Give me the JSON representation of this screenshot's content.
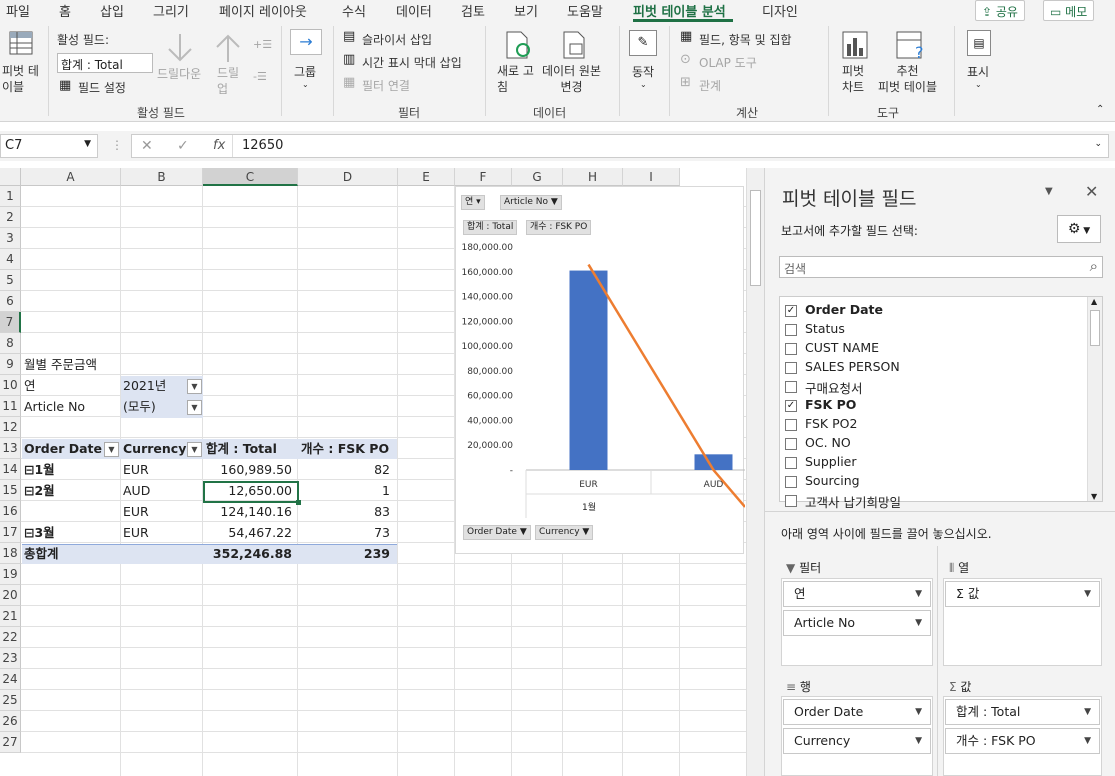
{
  "menubar": {
    "tabs": [
      "파일",
      "홈",
      "삽입",
      "그리기",
      "페이지 레이아웃",
      "수식",
      "데이터",
      "검토",
      "보기",
      "도움말",
      "피벗 테이블 분석",
      "디자인"
    ],
    "share": "공유",
    "memo": "메모"
  },
  "ribbon": {
    "pivot_table": "피벗 테\n이블",
    "active_field_label": "활성 필드:",
    "active_field_value": "합계 : Total",
    "field_settings": "필드 설정",
    "drill_down": "드릴다운",
    "drill_up": "드릴\n업",
    "active_field_group": "활성 필드",
    "group": "그룹",
    "insert_slicer": "슬라이서 삽입",
    "insert_timeline": "시간 표시 막대 삽입",
    "filter_connections": "필터 연결",
    "filter_group": "필터",
    "refresh": "새로 고\n침",
    "change_source": "데이터 원본\n변경",
    "data_group": "데이터",
    "actions": "동작",
    "fields_items_sets": "필드, 항목 및 집합",
    "olap_tools": "OLAP 도구",
    "relationships": "관계",
    "calc_group": "계산",
    "pivot_chart": "피벗\n차트",
    "recommended": "추천\n피벗 테이블",
    "tools_group": "도구",
    "show": "표시"
  },
  "formula_bar": {
    "name_box": "C7",
    "value": "12650"
  },
  "columns": [
    "A",
    "B",
    "C",
    "D",
    "E",
    "F",
    "G",
    "H",
    "I"
  ],
  "rows": [
    "1",
    "2",
    "3",
    "4",
    "5",
    "6",
    "7",
    "8",
    "9",
    "10",
    "11",
    "12",
    "13",
    "14",
    "15",
    "16",
    "17",
    "18",
    "19",
    "20",
    "21",
    "22",
    "23",
    "24",
    "25",
    "26",
    "27"
  ],
  "sheet": {
    "title": "월별 주문금액",
    "filter_year_label": "연",
    "filter_year_value": "2021년",
    "filter_article_label": "Article No",
    "filter_article_value": "(모두)",
    "headers": [
      "Order Date",
      "Currency",
      "합계 : Total",
      "개수 : FSK PO"
    ],
    "rows": [
      {
        "date": "1월",
        "currency": "EUR",
        "total": "160,989.50",
        "count": "82"
      },
      {
        "date": "2월",
        "currency": "AUD",
        "total": "12,650.00",
        "count": "1"
      },
      {
        "date": "",
        "currency": "EUR",
        "total": "124,140.16",
        "count": "83"
      },
      {
        "date": "3월",
        "currency": "EUR",
        "total": "54,467.22",
        "count": "73"
      }
    ],
    "grand_total_label": "총합계",
    "grand_total": "352,246.88",
    "grand_count": "239"
  },
  "chart_data": {
    "type": "bar",
    "filter_buttons": [
      "연",
      "Article No"
    ],
    "legend_buttons": [
      "합계 : Total",
      "개수 : FSK PO"
    ],
    "axis_buttons": [
      "Order Date",
      "Currency"
    ],
    "categories": [
      "EUR",
      "AUD"
    ],
    "group_label": "1월",
    "y_ticks": [
      "180,000.00",
      "160,000.00",
      "140,000.00",
      "120,000.00",
      "100,000.00",
      "80,000.00",
      "60,000.00",
      "40,000.00",
      "20,000.00",
      "-"
    ],
    "ylim": [
      0,
      180000
    ],
    "series": [
      {
        "name": "합계 : Total",
        "type": "bar",
        "values": [
          160989.5,
          12650
        ]
      },
      {
        "name": "개수 : FSK PO",
        "type": "line",
        "values": [
          82,
          1
        ]
      }
    ],
    "bar_color": "#4472c4",
    "line_color": "#ed7d31"
  },
  "pane": {
    "title": "피벗 테이블 필드",
    "subtitle": "보고서에 추가할 필드 선택:",
    "search_placeholder": "검색",
    "fields": [
      {
        "name": "Order Date",
        "checked": true
      },
      {
        "name": "Status",
        "checked": false
      },
      {
        "name": "CUST NAME",
        "checked": false
      },
      {
        "name": "SALES PERSON",
        "checked": false
      },
      {
        "name": "구매요청서",
        "checked": false
      },
      {
        "name": "FSK PO",
        "checked": true
      },
      {
        "name": "FSK PO2",
        "checked": false
      },
      {
        "name": "OC. NO",
        "checked": false
      },
      {
        "name": "Supplier",
        "checked": false
      },
      {
        "name": "Sourcing",
        "checked": false
      },
      {
        "name": "고객사 납기희망일",
        "checked": false
      }
    ],
    "drag_hint": "아래 영역 사이에 필드를 끌어 놓으십시오.",
    "filters_label": "필터",
    "columns_label": "열",
    "rows_label": "행",
    "values_label": "값",
    "filters": [
      "연",
      "Article No"
    ],
    "columns_items": [
      "Σ 값"
    ],
    "rows_items": [
      "Order Date",
      "Currency"
    ],
    "values_items": [
      "합계 : Total",
      "개수 : FSK PO"
    ]
  }
}
